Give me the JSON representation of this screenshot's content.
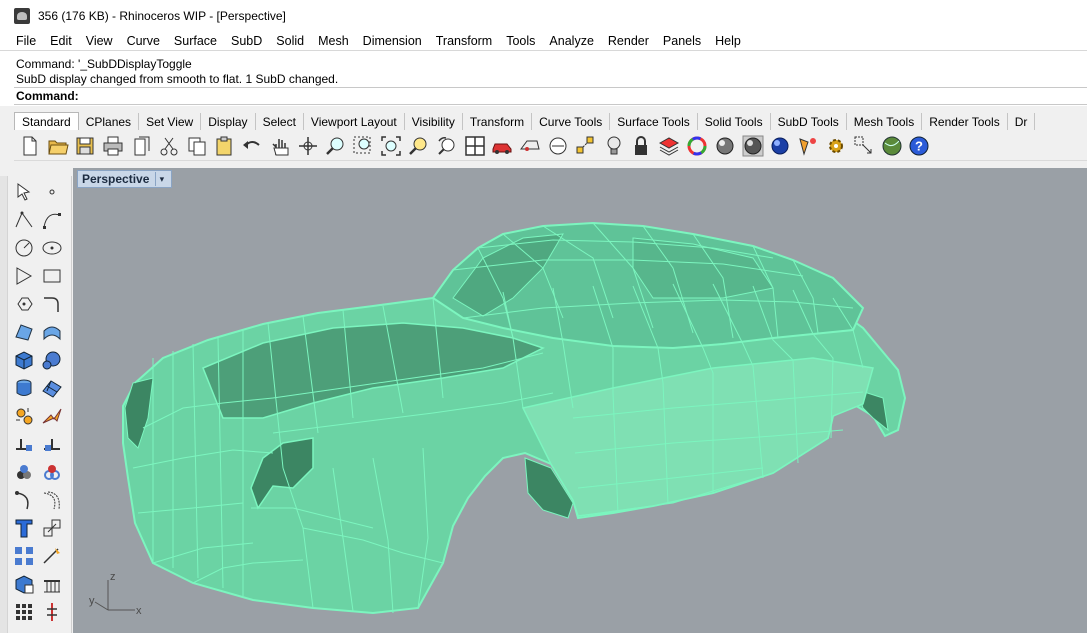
{
  "window": {
    "title": "356 (176 KB) - Rhinoceros WIP - [Perspective]"
  },
  "menu": [
    "File",
    "Edit",
    "View",
    "Curve",
    "Surface",
    "SubD",
    "Solid",
    "Mesh",
    "Dimension",
    "Transform",
    "Tools",
    "Analyze",
    "Render",
    "Panels",
    "Help"
  ],
  "command": {
    "history": [
      "Command: '_SubDDisplayToggle",
      "SubD display changed from smooth to flat. 1 SubD changed."
    ],
    "prompt_label": "Command:",
    "input_value": ""
  },
  "toolbar_tabs": [
    "Standard",
    "CPlanes",
    "Set View",
    "Display",
    "Select",
    "Viewport Layout",
    "Visibility",
    "Transform",
    "Curve Tools",
    "Surface Tools",
    "Solid Tools",
    "SubD Tools",
    "Mesh Tools",
    "Render Tools",
    "Dr"
  ],
  "active_tab": "Standard",
  "toolbar_icons": [
    "new-file-icon",
    "open-folder-icon",
    "save-icon",
    "print-icon",
    "import-icon",
    "cut-icon",
    "copy-icon",
    "paste-icon",
    "undo-icon",
    "pan-hand-icon",
    "rotate-view-icon",
    "zoom-icon",
    "zoom-window-icon",
    "zoom-extents-icon",
    "zoom-selected-icon",
    "rotate-camera-icon",
    "four-viewports-icon",
    "car-icon",
    "named-view-icon",
    "cplane-icon",
    "snap-icon",
    "light-bulb-icon",
    "lock-icon",
    "layer-icon",
    "color-wheel-icon",
    "shaded-sphere-icon",
    "rendered-sphere-icon",
    "blue-sphere-icon",
    "materials-icon",
    "gear-icon",
    "options-icon",
    "world-icon",
    "help-icon"
  ],
  "sidebar_icons": [
    "select-arrow-icon",
    "point-icon",
    "polyline-icon",
    "curve-points-icon",
    "circle-icon",
    "ellipse-icon",
    "polygon-icon",
    "rectangle-icon",
    "arc-icon",
    "fillet-curve-icon",
    "surface-corner-icon",
    "loft-icon",
    "box-solid-icon",
    "sphere-solid-icon",
    "cylinder-icon",
    "mesh-plane-icon",
    "explode-icon",
    "trim-icon",
    "split-icon",
    "join-icon",
    "group-icon",
    "boolean-icon",
    "curve-from-object-icon",
    "offset-icon",
    "text-icon",
    "scale-icon",
    "array-icon",
    "dimension-icon",
    "block-icon",
    "hatch-icon",
    "grid-snap-icon",
    "gumball-icon"
  ],
  "viewport": {
    "name": "Perspective",
    "background": "#9aa0a6",
    "model_color": "#6ad3a4",
    "edge_color": "#7cf5bf",
    "axis_labels": [
      "z",
      "y",
      "x"
    ]
  }
}
